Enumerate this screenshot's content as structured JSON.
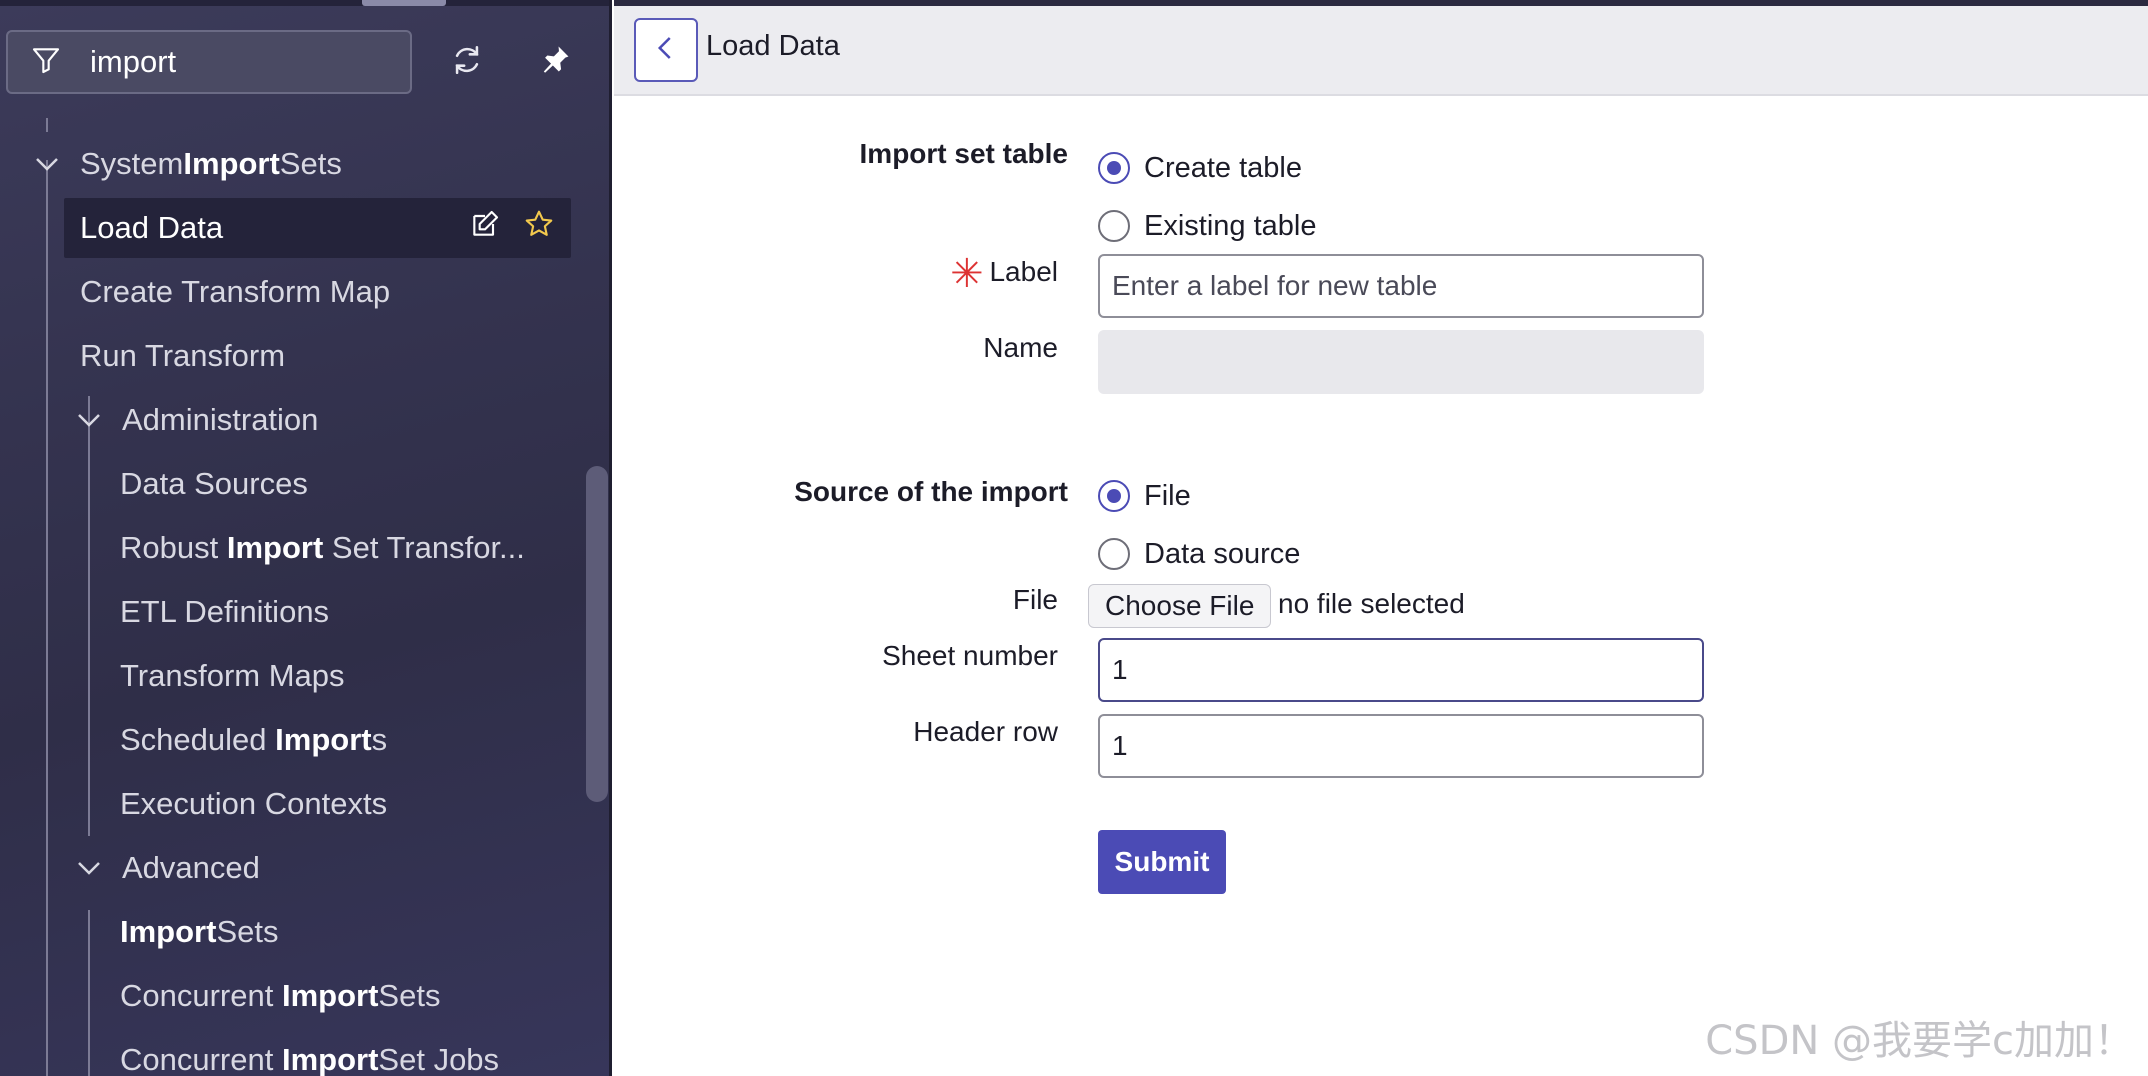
{
  "sidebar": {
    "filter": {
      "value": "import",
      "placeholder": "Filter"
    },
    "items": [
      {
        "pre": "System ",
        "match": "Import",
        "post": " Sets"
      },
      {
        "pre": "Load Data",
        "match": "",
        "post": ""
      },
      {
        "pre": "Create Transform Map",
        "match": "",
        "post": ""
      },
      {
        "pre": "Run Transform",
        "match": "",
        "post": ""
      },
      {
        "pre": "Administration",
        "match": "",
        "post": ""
      },
      {
        "pre": "Data Sources",
        "match": "",
        "post": ""
      },
      {
        "pre": "Robust ",
        "match": "Import",
        "post": " Set Transfor..."
      },
      {
        "pre": "ETL Definitions",
        "match": "",
        "post": ""
      },
      {
        "pre": "Transform Maps",
        "match": "",
        "post": ""
      },
      {
        "pre": "Scheduled ",
        "match": "Import",
        "post": "s"
      },
      {
        "pre": "Execution Contexts",
        "match": "",
        "post": ""
      },
      {
        "pre": "Advanced",
        "match": "",
        "post": ""
      },
      {
        "pre": "",
        "match": "Import",
        "post": " Sets"
      },
      {
        "pre": "Concurrent ",
        "match": "Import",
        "post": " Sets"
      },
      {
        "pre": "Concurrent ",
        "match": "Import",
        "post": " Set Jobs"
      }
    ]
  },
  "header": {
    "title": "Load Data"
  },
  "form": {
    "import_set_table_label": "Import set table",
    "create_table_label": "Create table",
    "existing_table_label": "Existing table",
    "label_field_label": "Label",
    "label_placeholder": "Enter a label for new table",
    "name_field_label": "Name",
    "source_label": "Source of the import",
    "source_file_label": "File",
    "source_datasource_label": "Data source",
    "file_field_label": "File",
    "choose_file_label": "Choose File",
    "file_status": "no file selected",
    "sheet_number_label": "Sheet number",
    "sheet_number_value": "1",
    "header_row_label": "Header row",
    "header_row_value": "1",
    "submit_label": "Submit"
  },
  "watermark": "CSDN @我要学c加加！",
  "colors": {
    "accent": "#4b4bb5",
    "sidebar_bg": "#34334f",
    "required": "#dd3333"
  }
}
